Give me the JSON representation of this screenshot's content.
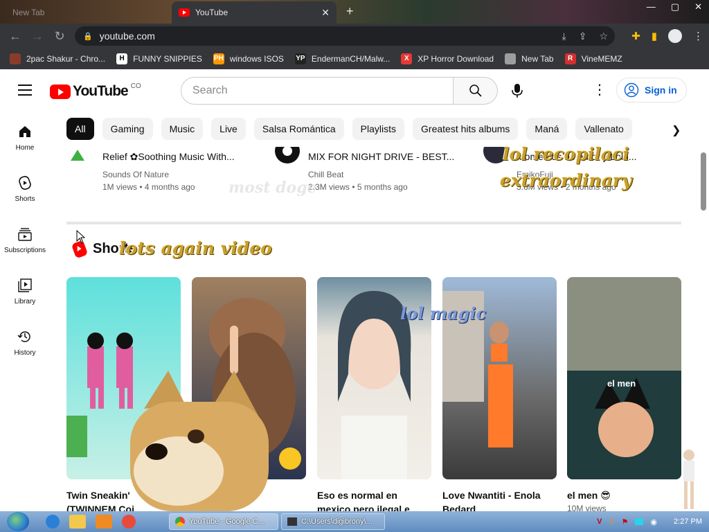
{
  "browser": {
    "tabs": [
      {
        "label": "New Tab",
        "active": false
      },
      {
        "label": "YouTube",
        "active": true
      }
    ],
    "new_tab_symbol": "+",
    "close_symbol": "✕",
    "window_controls": [
      "—",
      "▢",
      "✕"
    ],
    "url": "youtube.com",
    "bookmarks": [
      {
        "label": "2pac Shakur - Chro...",
        "icon": "tupac-icon",
        "icon_color": "#8a3b2a",
        "icon_text": ""
      },
      {
        "label": "FUNNY SNIPPIES",
        "icon": "h-icon",
        "icon_color": "#ffffff",
        "icon_text": "H"
      },
      {
        "label": "windows ISOS",
        "icon": "ph-icon",
        "icon_color": "#ff9800",
        "icon_text": "PH"
      },
      {
        "label": "EndermanCH/Malw...",
        "icon": "yp-icon",
        "icon_color": "#222222",
        "icon_text": "YP"
      },
      {
        "label": "XP Horror Download",
        "icon": "x-icon",
        "icon_color": "#e53935",
        "icon_text": "X"
      },
      {
        "label": "New Tab",
        "icon": "globe-icon",
        "icon_color": "#9e9e9e",
        "icon_text": ""
      },
      {
        "label": "VineMEMZ",
        "icon": "r-icon",
        "icon_color": "#d32f2f",
        "icon_text": "R"
      }
    ]
  },
  "youtube": {
    "logo_text": "YouTube",
    "country_code": "CO",
    "search_placeholder": "Search",
    "sign_in_label": "Sign in",
    "sidebar": [
      {
        "label": "Home",
        "icon": "home-icon"
      },
      {
        "label": "Shorts",
        "icon": "shorts-icon"
      },
      {
        "label": "Subscriptions",
        "icon": "subscriptions-icon"
      },
      {
        "label": "Library",
        "icon": "library-icon"
      },
      {
        "label": "History",
        "icon": "history-icon"
      }
    ],
    "chips": [
      "All",
      "Gaming",
      "Music",
      "Live",
      "Salsa Romántica",
      "Playlists",
      "Greatest hits albums",
      "Maná",
      "Vallenato"
    ],
    "videos": [
      {
        "title": "Relief ✿Soothing Music With...",
        "channel": "Sounds Of Nature",
        "views": "1M views",
        "age": "4 months ago"
      },
      {
        "title": "MIX FOR NIGHT DRIVE - BEST...",
        "channel": "Chill Beat",
        "views": "2.3M views",
        "age": "5 months ago"
      },
      {
        "title": "Momentos de amor y Loid...",
        "channel": "EmikoFuji",
        "views": "3.6M views",
        "age": "2 months ago"
      }
    ],
    "shorts_heading": "Shorts",
    "shorts": [
      {
        "title_line1": "Twin Sneakin'",
        "title_line2": "(TWINNEM Coi",
        "views": "",
        "thumb_colors": [
          "#5ee0dc",
          "#c7f0e6"
        ]
      },
      {
        "title_line1": "",
        "title_line2": "",
        "views": "",
        "thumb_colors": [
          "#8a6b52",
          "#2a3450"
        ]
      },
      {
        "title_line1": "Eso es normal en",
        "title_line2": "mexico pero ilegal e...",
        "views": "",
        "thumb_colors": [
          "#d8d4cc",
          "#f2efe8"
        ]
      },
      {
        "title_line1": "Love Nwantiti - Enola",
        "title_line2": "Bedard",
        "views": "",
        "thumb_colors": [
          "#7fa0c8",
          "#5a5a5a"
        ]
      },
      {
        "title_line1": "el men 😎",
        "title_line2": "",
        "views": "10M views",
        "thumb_colors": [
          "#6f7a6a",
          "#2c4a4a"
        ],
        "overlay_text": "el men"
      }
    ]
  },
  "memes": {
    "most_doge": "most doge",
    "lol_recopilaci": "lol recopilaci",
    "extraordinary": "extraordinary",
    "lots_again_video": "lots again video",
    "lol_magic": "lol magic"
  },
  "taskbar": {
    "tasks": [
      {
        "label": "YouTube - Google C..."
      },
      {
        "label": "C:\\Users\\digibrony\\..."
      }
    ],
    "clock": "2:27 PM"
  }
}
